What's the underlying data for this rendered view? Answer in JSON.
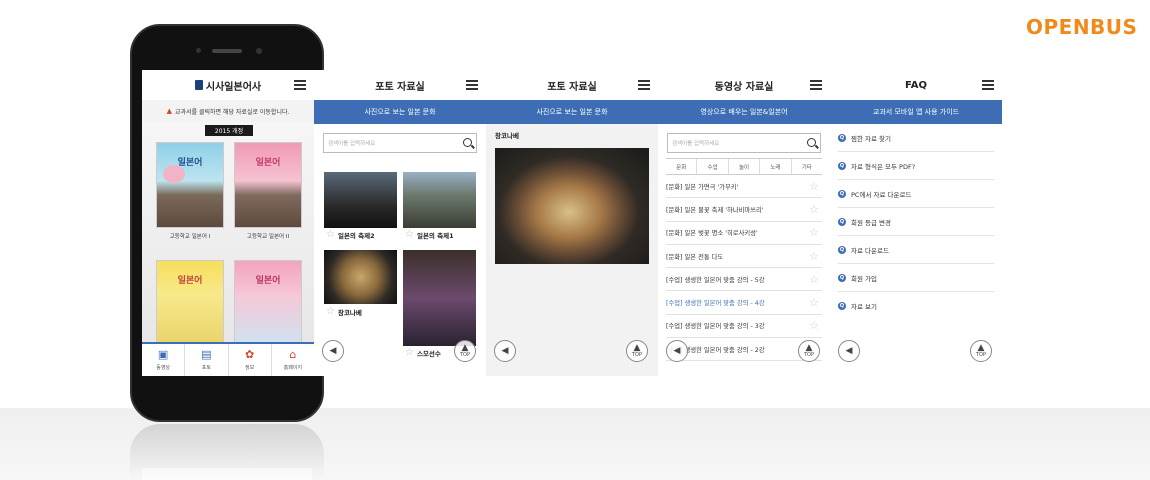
{
  "brand": {
    "logo": "OPENBUS",
    "color": "#f08a1c"
  },
  "accent": "#3d6db5",
  "screen1": {
    "title": "시사일본어사",
    "notice": "교과서를 클릭하면 해당 자료실로 이동합니다.",
    "edition": "2015 개정",
    "books": [
      {
        "cover": "일본어",
        "label": "고등학교 일본어 I"
      },
      {
        "cover": "일본어",
        "label": "고등학교 일본어 II"
      },
      {
        "cover": "일본어",
        "label": ""
      },
      {
        "cover": "일본어",
        "label": ""
      }
    ],
    "tabs": [
      {
        "label": "동영상",
        "icon": "video-icon"
      },
      {
        "label": "포토",
        "icon": "photo-icon"
      },
      {
        "label": "정보",
        "icon": "flower-icon"
      },
      {
        "label": "홈페이지",
        "icon": "home-icon"
      }
    ]
  },
  "screen2": {
    "title": "포토 자료실",
    "subtitle": "사진으로 보는 일본 문화",
    "search_placeholder": "검색어를 입력하세요",
    "items": [
      "일본의 축제2",
      "일본의 축제1",
      "창코나베",
      "스모선수"
    ],
    "top_label": "TOP"
  },
  "screen3": {
    "title": "포토 자료실",
    "subtitle": "사진으로 보는 일본 문화",
    "photo_title": "창코나베",
    "top_label": "TOP"
  },
  "screen4": {
    "title": "동영상 자료실",
    "subtitle": "영상으로 배우는 일본&일본어",
    "search_placeholder": "검색어를 입력하세요",
    "categories": [
      "문화",
      "수업",
      "놀이",
      "노래",
      "기타"
    ],
    "videos": [
      "[문화] 일본 가면극 '가부키'",
      "[문화] 일본 불꽃 축제 '하나비마쓰리'",
      "[문화] 일본 벚꽃 명소 '히로사키성'",
      "[문화] 일본 전통 다도",
      "[수업] 생생한 일본어 맞춤 강의 - 5강",
      "[수업] 생생한 일본어 맞춤 강의 - 4강",
      "[수업] 생생한 일본어 맞춤 강의 - 3강",
      "[수업] 생생한 일본어 맞춤 강의 - 2강"
    ],
    "active_index": 5,
    "top_label": "TOP"
  },
  "screen5": {
    "title": "FAQ",
    "subtitle": "교과서 모바일 앱 사용 가이드",
    "q_badge": "Q",
    "faqs": [
      "찜한 자료 찾기",
      "자료 형식은 모두 PDF?",
      "PC에서 자료 다운로드",
      "회원 등급 변경",
      "자료 다운로드",
      "회원 가입",
      "자료 보기"
    ],
    "top_label": "TOP"
  }
}
